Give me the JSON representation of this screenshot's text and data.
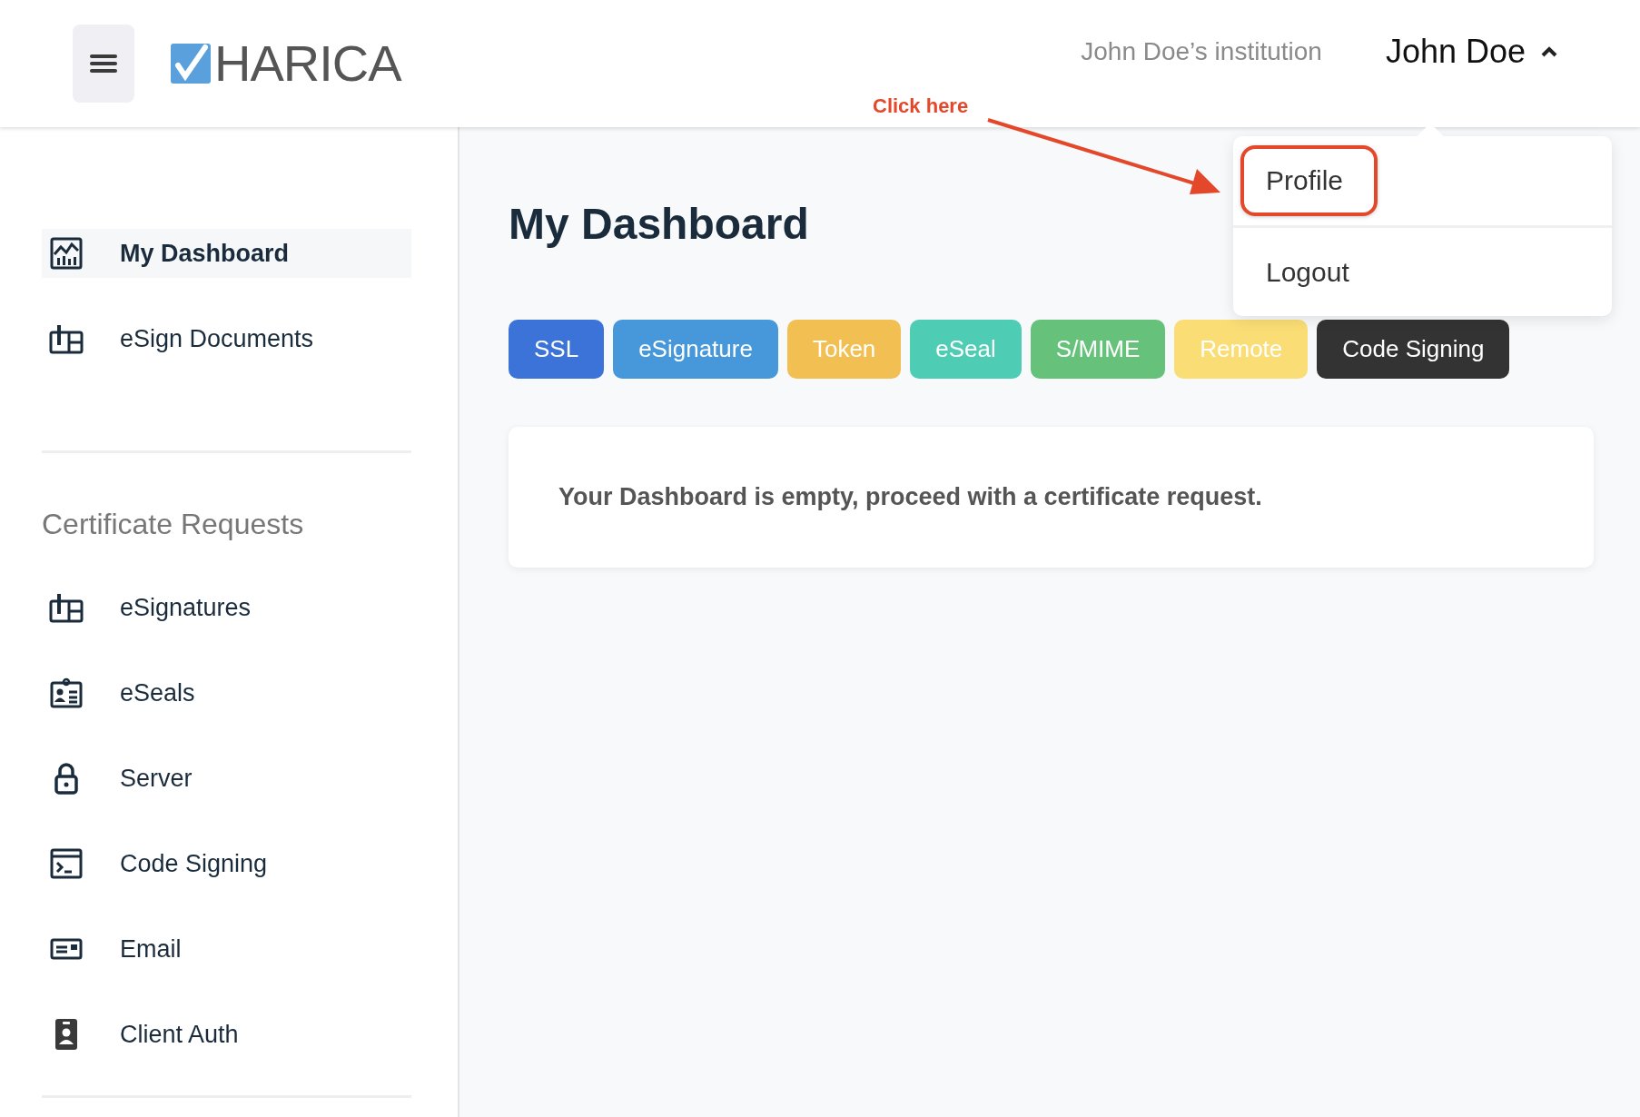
{
  "header": {
    "logo": "HARICA",
    "institution": "John Doe’s institution",
    "user": "John Doe",
    "menu_expanded": true
  },
  "annotation": {
    "text": "Click here"
  },
  "user_menu": [
    {
      "label": "Profile",
      "highlighted": true
    },
    {
      "label": "Logout",
      "highlighted": false
    }
  ],
  "sidebar": {
    "items": [
      {
        "label": "My Dashboard",
        "kind": "chart",
        "selected": true
      },
      {
        "label": "eSign Documents",
        "kind": "sign",
        "selected": false
      }
    ],
    "section_title": "Certificate Requests",
    "section_items": [
      {
        "label": "eSignatures",
        "kind": "sign",
        "selected": false
      },
      {
        "label": "eSeals",
        "kind": "badge",
        "selected": false
      },
      {
        "label": "Server",
        "kind": "lock",
        "selected": false
      },
      {
        "label": "Code Signing",
        "kind": "terminal",
        "selected": false
      },
      {
        "label": "Email",
        "kind": "card",
        "selected": false
      },
      {
        "label": "Client Auth",
        "kind": "id",
        "selected": false
      }
    ]
  },
  "main": {
    "title": "My Dashboard",
    "filters": [
      {
        "label": "SSL",
        "color": "#3b73d9"
      },
      {
        "label": "eSignature",
        "color": "#4698db"
      },
      {
        "label": "Token",
        "color": "#f2bf52"
      },
      {
        "label": "eSeal",
        "color": "#4ecdb4"
      },
      {
        "label": "S/MIME",
        "color": "#66c27a"
      },
      {
        "label": "Remote",
        "color": "#fadd74"
      },
      {
        "label": "Code Signing",
        "color": "#333333"
      }
    ],
    "empty_message": "Your Dashboard is empty, proceed with a certificate request."
  }
}
